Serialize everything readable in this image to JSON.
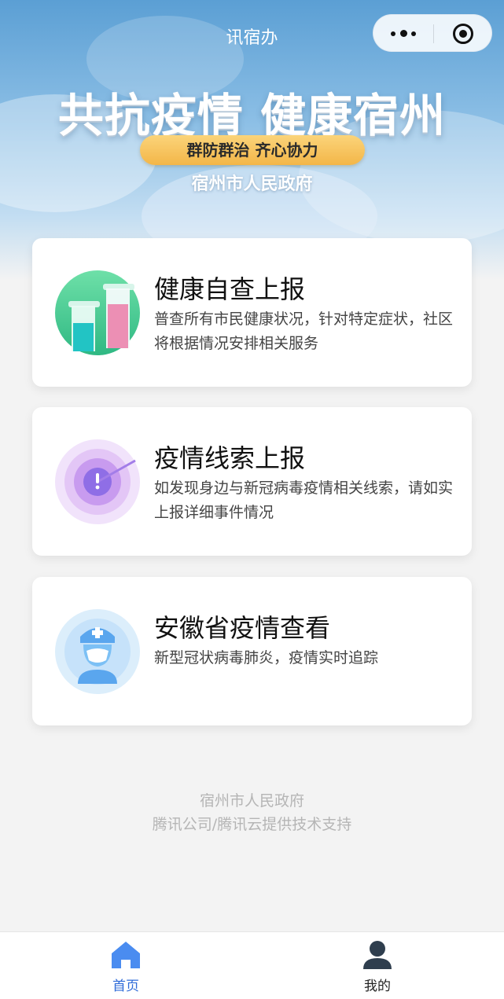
{
  "navbar": {
    "title": "讯宿办",
    "menu_icon": "more-dots-icon",
    "close_icon": "target-icon"
  },
  "banner": {
    "headline": "共抗疫情 健康宿州",
    "slogan": "群防群治  齐心协力",
    "organization": "宿州市人民政府"
  },
  "cards": [
    {
      "icon": "test-tubes-icon",
      "title": "健康自查上报",
      "description": "普查所有市民健康状况，针对特定症状，社区将根据情况安排相关服务"
    },
    {
      "icon": "radar-alert-icon",
      "title": "疫情线索上报",
      "description": "如发现身边与新冠病毒疫情相关线索，请如实上报详细事件情况"
    },
    {
      "icon": "doctor-icon",
      "title": "安徽省疫情查看",
      "description": "新型冠状病毒肺炎，疫情实时追踪"
    }
  ],
  "footer": {
    "line1": "宿州市人民政府",
    "line2": "腾讯公司/腾讯云提供技术支持"
  },
  "tabbar": {
    "home_label": "首页",
    "mine_label": "我的",
    "active_color": "#2f6bd8"
  }
}
